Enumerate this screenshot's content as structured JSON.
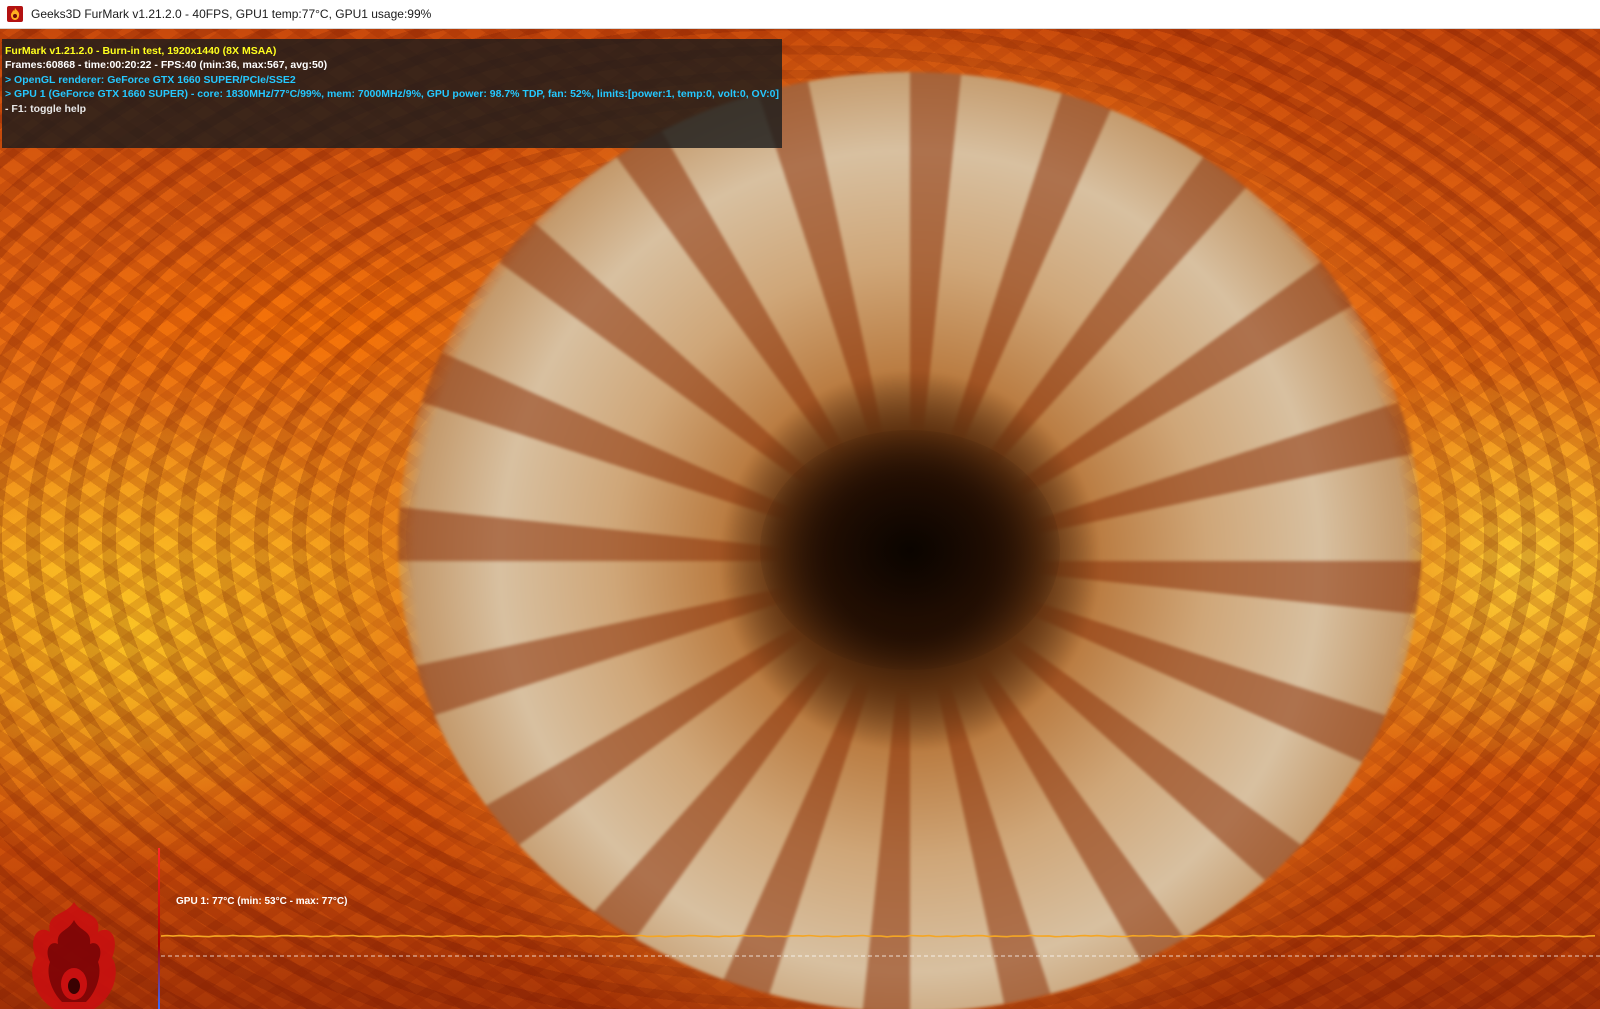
{
  "window": {
    "title": "Geeks3D FurMark v1.21.2.0 - 40FPS, GPU1 temp:77°C, GPU1 usage:99%",
    "icon": "furmark-flame-icon"
  },
  "hud": {
    "lines": [
      "FurMark v1.21.2.0 - Burn-in test, 1920x1440 (8X MSAA)",
      "Frames:60868 - time:00:20:22 - FPS:40 (min:36, max:567, avg:50)",
      "> OpenGL renderer: GeForce GTX 1660 SUPER/PCIe/SSE2",
      "> GPU 1 (GeForce GTX 1660 SUPER) - core: 1830MHz/77°C/99%, mem: 7000MHz/9%, GPU power: 98.7% TDP, fan: 52%, limits:[power:1, temp:0, volt:0, OV:0]",
      "- F1: toggle help"
    ]
  },
  "monitor": {
    "label": "GPU 1: 77°C (min: 53°C - max: 77°C)",
    "current_temp": 77,
    "min_temp": 53,
    "max_temp": 77,
    "line_color": "#f5a623"
  },
  "colors": {
    "hud_yellow": "#ffff1e",
    "hud_cyan": "#25c8ff",
    "logo_red": "#c81010"
  }
}
